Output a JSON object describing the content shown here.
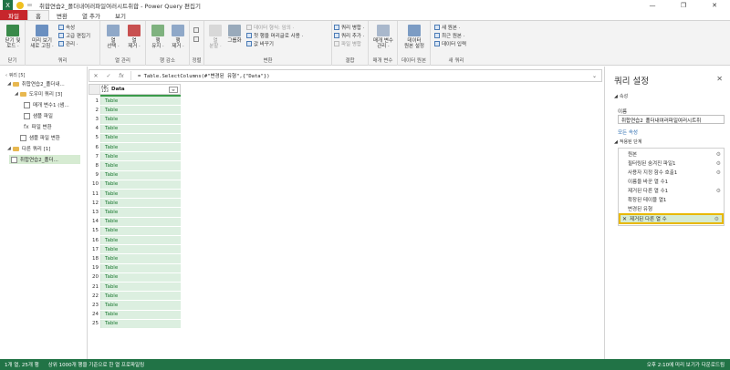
{
  "window": {
    "title": "취합연습2_폴더내여러파일여러시트취합 - Power Query 편집기"
  },
  "tabs": [
    "파일",
    "홈",
    "변환",
    "열 추가",
    "보기"
  ],
  "ribbon": {
    "close_group": {
      "btn": "닫기 및\n로드 ·",
      "label": "닫기"
    },
    "query_group": {
      "refresh": "미리 보기\n새로 고침 ·",
      "properties": "속성",
      "advanced_editor": "고급 편집기",
      "manage": "관리 ·",
      "label": "쿼리"
    },
    "columns_group": {
      "choose": "열\n선택 ·",
      "remove": "열\n제거 ·",
      "label": "열 관리"
    },
    "rows_group": {
      "keep": "행\n유지 ·",
      "remove": "행\n제거 ·",
      "label": "행 감소"
    },
    "sort_group": {
      "label": "정렬"
    },
    "transform_group": {
      "split": "열\n분할 ·",
      "group_by": "그룹화",
      "data_type": "데이터 형식: 임의 ·",
      "first_row": "첫 행을 머리글로 사용 ·",
      "replace": "값 바꾸기",
      "label": "변환"
    },
    "combine_group": {
      "merge": "쿼리 병합 ·",
      "append": "쿼리 추가 ·",
      "combine_files": "파일 병합",
      "label": "결합"
    },
    "params_group": {
      "manage": "매개 변수\n관리 ·",
      "label": "매개 변수"
    },
    "datasource_group": {
      "settings": "데이터\n원본 설정",
      "label": "데이터 원본"
    },
    "newquery_group": {
      "new_source": "새 원본 ·",
      "recent": "최근 원본 ·",
      "enter_data": "데이터 입력",
      "label": "새 쿼리"
    }
  },
  "queries": {
    "header": "쿼리 [5]",
    "items": [
      {
        "label": "취합연습2_폴더내..."
      },
      {
        "label": "도우미 쿼리 [3]"
      },
      {
        "label": "매개 변수1 (샘..."
      },
      {
        "label": "샘플 파일"
      },
      {
        "label": "파일 변환"
      },
      {
        "label": "샘플 파일 변환"
      },
      {
        "label": "다른 쿼리 [1]"
      },
      {
        "label": "취합연습2_폴더..."
      }
    ]
  },
  "formula": {
    "text": "= Table.SelectColumns(#\"변경된 유형\",{\"Data\"})"
  },
  "grid": {
    "type_label": "ABC\n123",
    "column": "Data",
    "rows": [
      {
        "n": "1",
        "v": "Table"
      },
      {
        "n": "2",
        "v": "Table"
      },
      {
        "n": "3",
        "v": "Table"
      },
      {
        "n": "4",
        "v": "Table"
      },
      {
        "n": "5",
        "v": "Table"
      },
      {
        "n": "6",
        "v": "Table"
      },
      {
        "n": "7",
        "v": "Table"
      },
      {
        "n": "8",
        "v": "Table"
      },
      {
        "n": "9",
        "v": "Table"
      },
      {
        "n": "10",
        "v": "Table"
      },
      {
        "n": "11",
        "v": "Table"
      },
      {
        "n": "12",
        "v": "Table"
      },
      {
        "n": "13",
        "v": "Table"
      },
      {
        "n": "14",
        "v": "Table"
      },
      {
        "n": "15",
        "v": "Table"
      },
      {
        "n": "16",
        "v": "Table"
      },
      {
        "n": "17",
        "v": "Table"
      },
      {
        "n": "18",
        "v": "Table"
      },
      {
        "n": "19",
        "v": "Table"
      },
      {
        "n": "20",
        "v": "Table"
      },
      {
        "n": "21",
        "v": "Table"
      },
      {
        "n": "22",
        "v": "Table"
      },
      {
        "n": "23",
        "v": "Table"
      },
      {
        "n": "24",
        "v": "Table"
      },
      {
        "n": "25",
        "v": "Table"
      }
    ]
  },
  "settings": {
    "title": "쿼리 설정",
    "properties": "속성",
    "name_label": "이름",
    "name_value": "취합연습2_폴더내여러파일여러시트취",
    "all_props": "모든 속성",
    "applied_steps": "적용된 단계",
    "steps": [
      {
        "label": "원본",
        "gear": true
      },
      {
        "label": "필터링된 숨겨진 파일1",
        "gear": true
      },
      {
        "label": "사용자 지정 함수 호출1",
        "gear": true
      },
      {
        "label": "이름을 바꾼 열 수1",
        "gear": false
      },
      {
        "label": "제거된 다른 열 수1",
        "gear": true
      },
      {
        "label": "확장된 테이블 열1",
        "gear": false
      },
      {
        "label": "변경된 유형",
        "gear": false
      },
      {
        "label": "제거된 다른 열 수",
        "gear": true,
        "selected": true
      }
    ]
  },
  "status": {
    "left": "1개 열, 25개 행",
    "middle": "상위 1000개 행을 기준으로 한 열 프로파일링",
    "right": "오후 2:10에 미리 보기가 다운로드됨"
  },
  "colors": {
    "accent_green": "#217346",
    "file_tab": "#c7262c",
    "selected_highlight": "#e8b800"
  }
}
